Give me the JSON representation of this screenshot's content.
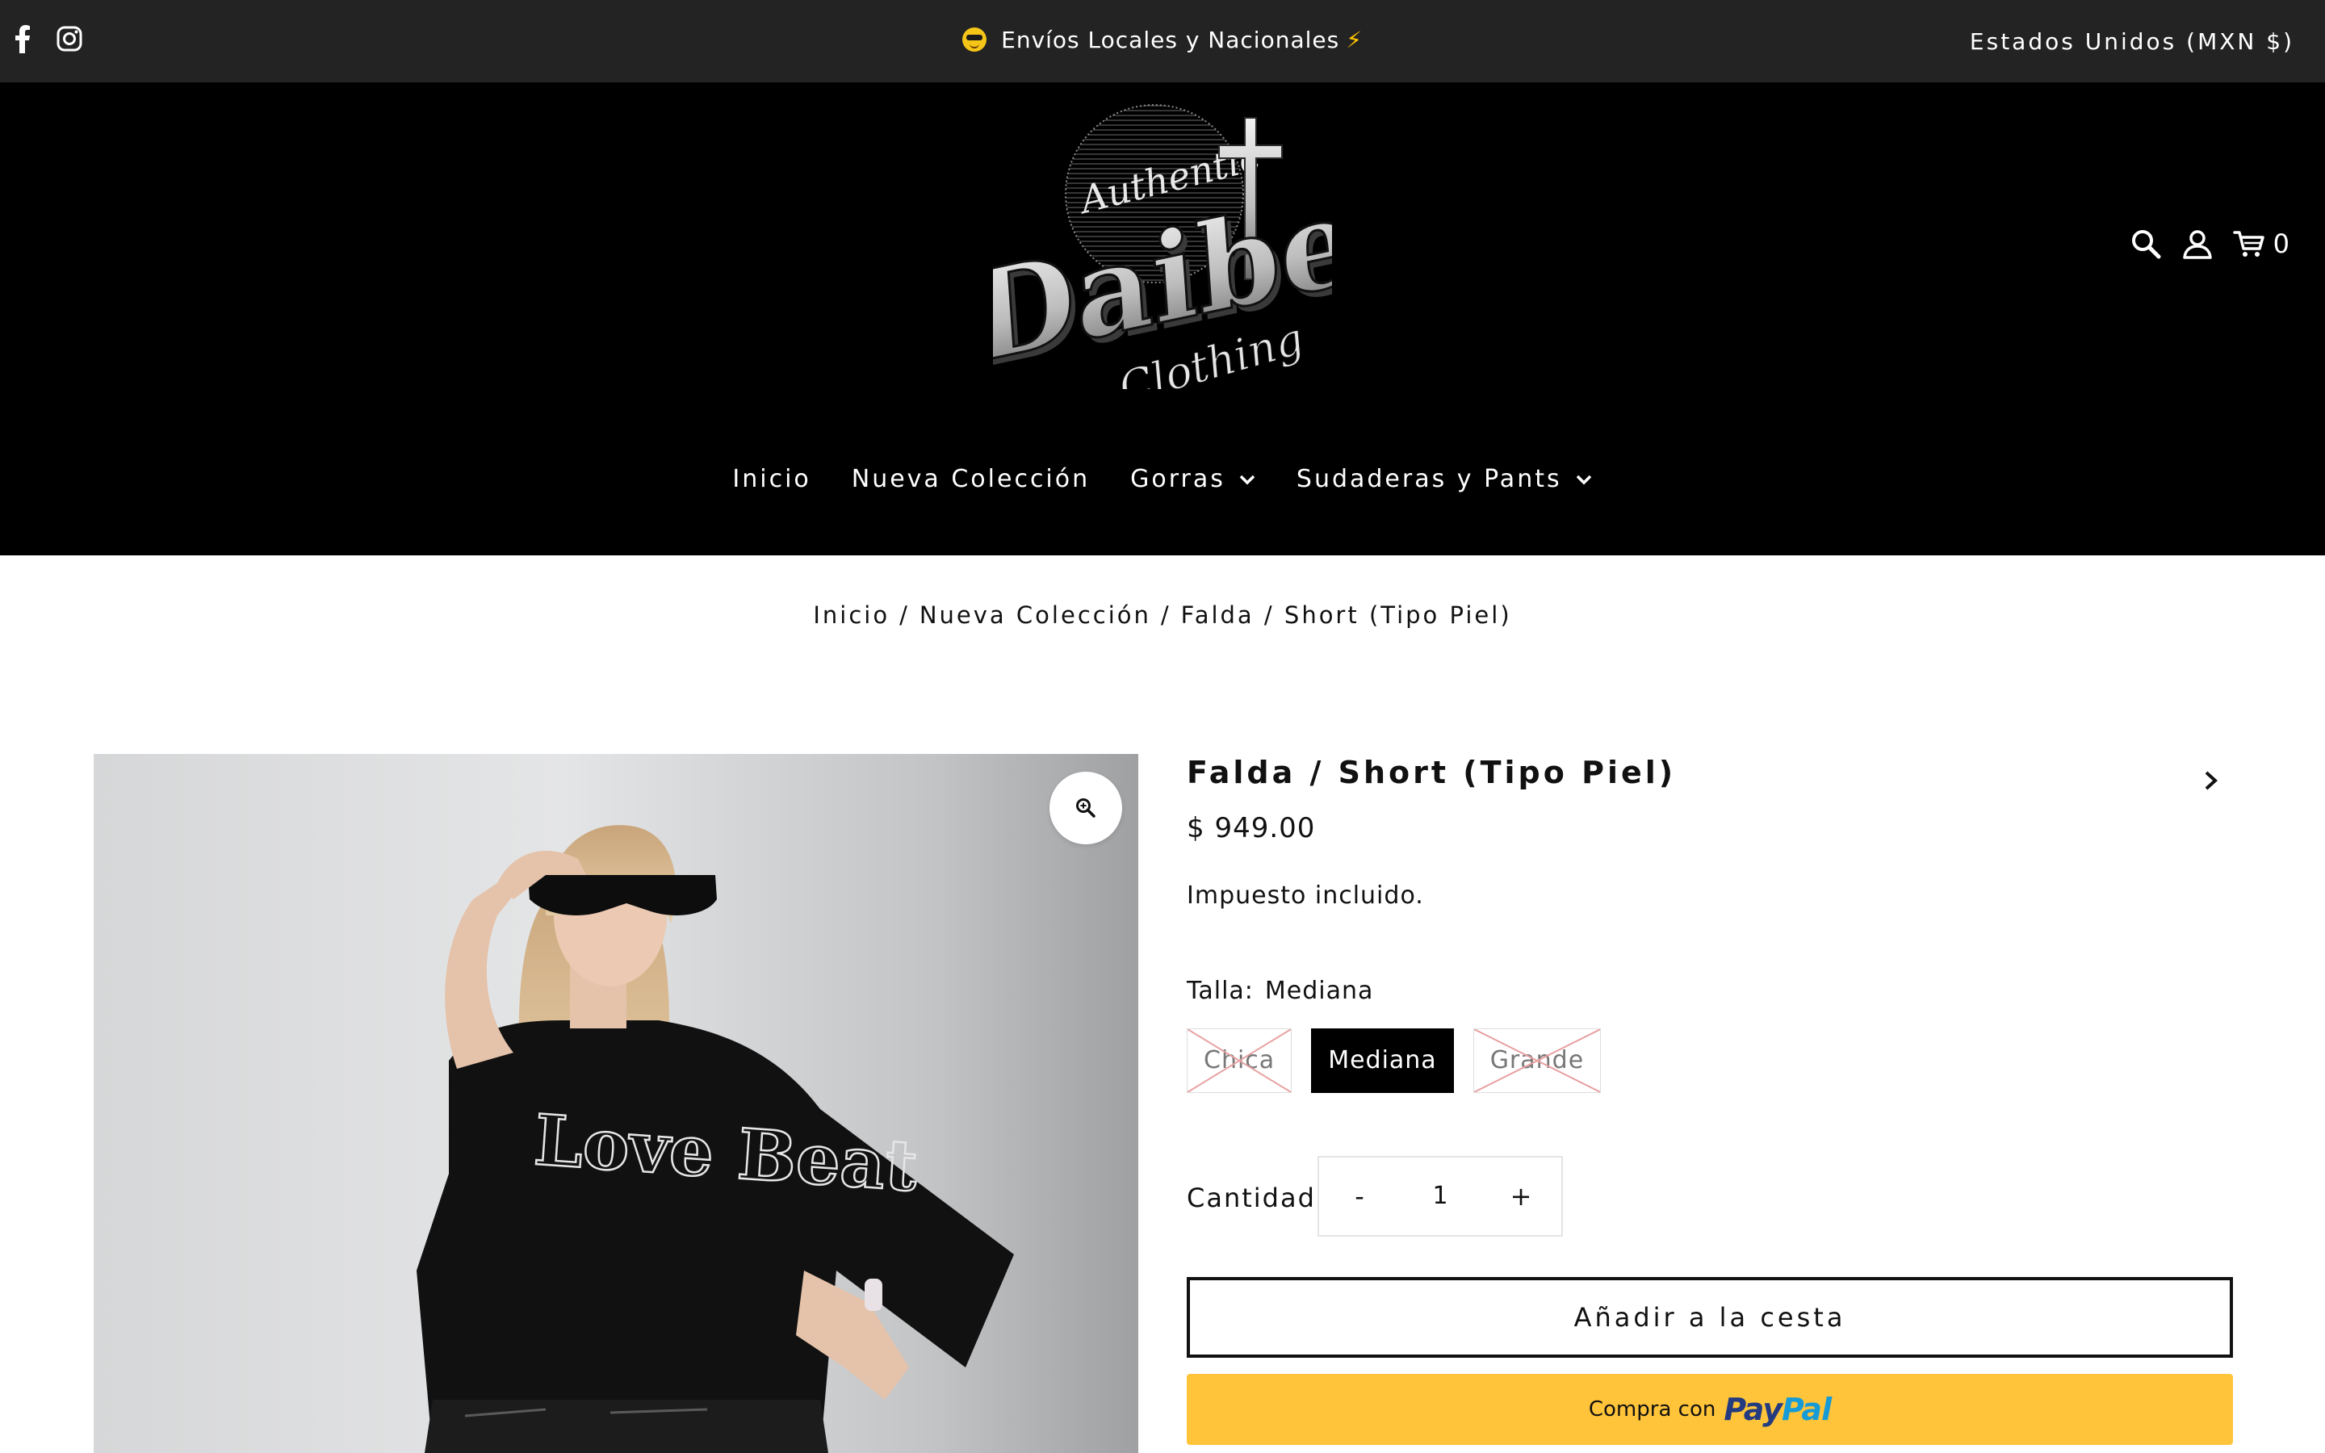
{
  "announcement": {
    "text": "Envíos Locales y Nacionales",
    "bolt": "⚡"
  },
  "currency": "Estados Unidos (MXN $)",
  "social": [
    "facebook-icon",
    "instagram-icon"
  ],
  "logo": {
    "line1": "Authentic",
    "line2": "Daibeat",
    "line3": "Clothing"
  },
  "header": {
    "cart_count": "0",
    "icons": [
      "search-icon",
      "account-icon",
      "cart-icon"
    ]
  },
  "nav": {
    "items": [
      {
        "label": "Inicio"
      },
      {
        "label": "Nueva Colección"
      },
      {
        "label": "Gorras"
      },
      {
        "label": "Sudaderas y Pants"
      }
    ]
  },
  "breadcrumb": {
    "home": "Inicio",
    "collection": "Nueva Colección",
    "current": "Falda / Short (Tipo Piel)",
    "separator": "/"
  },
  "product": {
    "title": "Falda / Short (Tipo Piel)",
    "price": "$ 949.00",
    "tax_note": "Impuesto incluido.",
    "size_label": "Talla:",
    "size_selected": "Mediana",
    "sizes": [
      {
        "label": "Chica",
        "available": false
      },
      {
        "label": "Mediana",
        "available": true
      },
      {
        "label": "Grande",
        "available": false
      }
    ],
    "quantity_label": "Cantidad",
    "quantity": "1",
    "minus": "-",
    "plus": "+",
    "add_to_cart": "Añadir a la cesta",
    "paypal_prefix": "Compra con",
    "paypal_pay": "Pay",
    "paypal_pal": "Pal",
    "shirt_print": "Love Beat"
  },
  "colors": {
    "topbar": "#232323",
    "header": "#000000",
    "paypal": "#ffc439",
    "soldout_cross": "#e8a0a0"
  }
}
